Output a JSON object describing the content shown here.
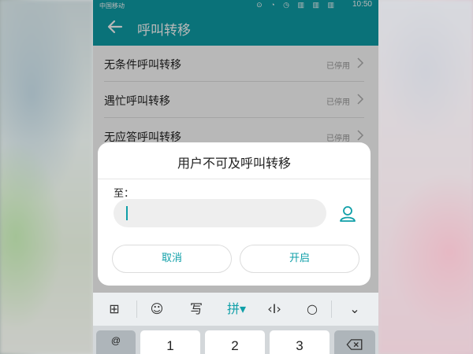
{
  "statusbar": {
    "carrier": "中国移动",
    "icons": "⊙ ◔ ◷ ▥ ▥ ▥",
    "time": "10:50"
  },
  "appbar": {
    "title": "呼叫转移",
    "back_icon": "arrow-left-icon"
  },
  "list": {
    "items": [
      {
        "label": "无条件呼叫转移",
        "status": "已停用"
      },
      {
        "label": "遇忙呼叫转移",
        "status": "已停用"
      },
      {
        "label": "无应答呼叫转移",
        "status": "已停用"
      }
    ]
  },
  "dialog": {
    "title": "用户不可及呼叫转移",
    "to_label": "至：",
    "input_value": "",
    "cancel_label": "取消",
    "ok_label": "开启"
  },
  "keyboard": {
    "tools": [
      {
        "name": "grid-icon",
        "glyph": "⊞"
      },
      {
        "name": "emoji-icon",
        "glyph": "☺"
      },
      {
        "name": "handwriting-icon",
        "glyph": "写"
      },
      {
        "name": "pinyin-mode",
        "glyph": "拼▾"
      },
      {
        "name": "cursor-icon",
        "glyph": "‹I›"
      },
      {
        "name": "search-icon",
        "glyph": "○"
      },
      {
        "name": "collapse-icon",
        "glyph": "⌄"
      }
    ],
    "keys": {
      "symbol": "@",
      "k1": "1",
      "k2": "2",
      "k3": "3",
      "backspace_icon": "backspace-icon"
    }
  },
  "colors": {
    "accent": "#0f9fa8",
    "status_gray": "#9a9a9a"
  }
}
